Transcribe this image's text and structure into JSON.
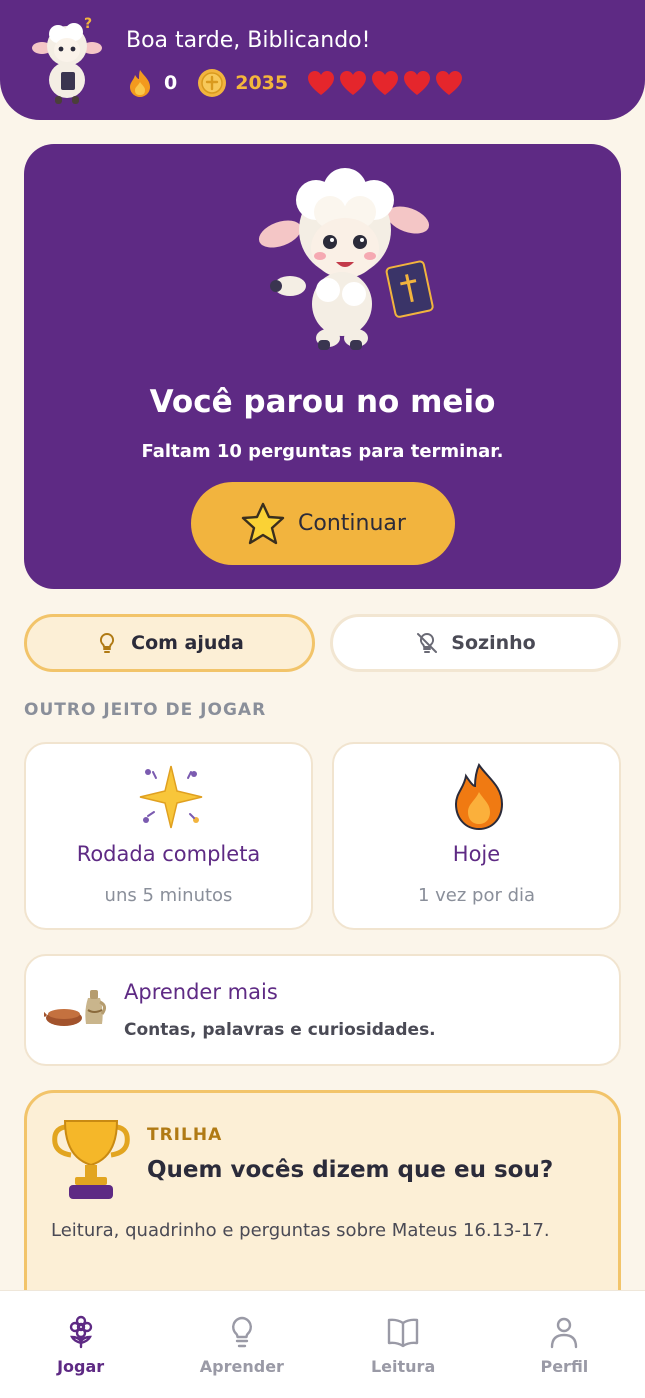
{
  "header": {
    "greeting": "Boa tarde, Biblicando!",
    "streak": "0",
    "coins": "2035",
    "hearts": 5
  },
  "resume": {
    "title": "Você parou no meio",
    "subtitle": "Faltam 10 perguntas para terminar.",
    "button_label": "Continuar"
  },
  "modes": {
    "help_label": "Com ajuda",
    "solo_label": "Sozinho",
    "selected": "help"
  },
  "section_label": "OUTRO JEITO DE JOGAR",
  "cards": {
    "full_round": {
      "title": "Rodada completa",
      "subtitle": "uns 5 minutos"
    },
    "today": {
      "title": "Hoje",
      "subtitle": "1 vez por dia"
    }
  },
  "learn_more": {
    "title": "Aprender mais",
    "subtitle": "Contas, palavras e curiosidades."
  },
  "trail": {
    "label": "TRILHA",
    "title": "Quem vocês dizem que eu sou?",
    "description": "Leitura, quadrinho e perguntas sobre Mateus 16.13-17."
  },
  "nav": {
    "items": [
      {
        "label": "Jogar",
        "icon": "flower-icon",
        "active": true
      },
      {
        "label": "Aprender",
        "icon": "lightbulb-icon",
        "active": false
      },
      {
        "label": "Leitura",
        "icon": "book-icon",
        "active": false
      },
      {
        "label": "Perfil",
        "icon": "person-icon",
        "active": false
      }
    ]
  },
  "colors": {
    "brand_purple": "#5E2A84",
    "accent_gold": "#F2B43E",
    "heart_red": "#E5262C",
    "background": "#FBF5EA"
  }
}
